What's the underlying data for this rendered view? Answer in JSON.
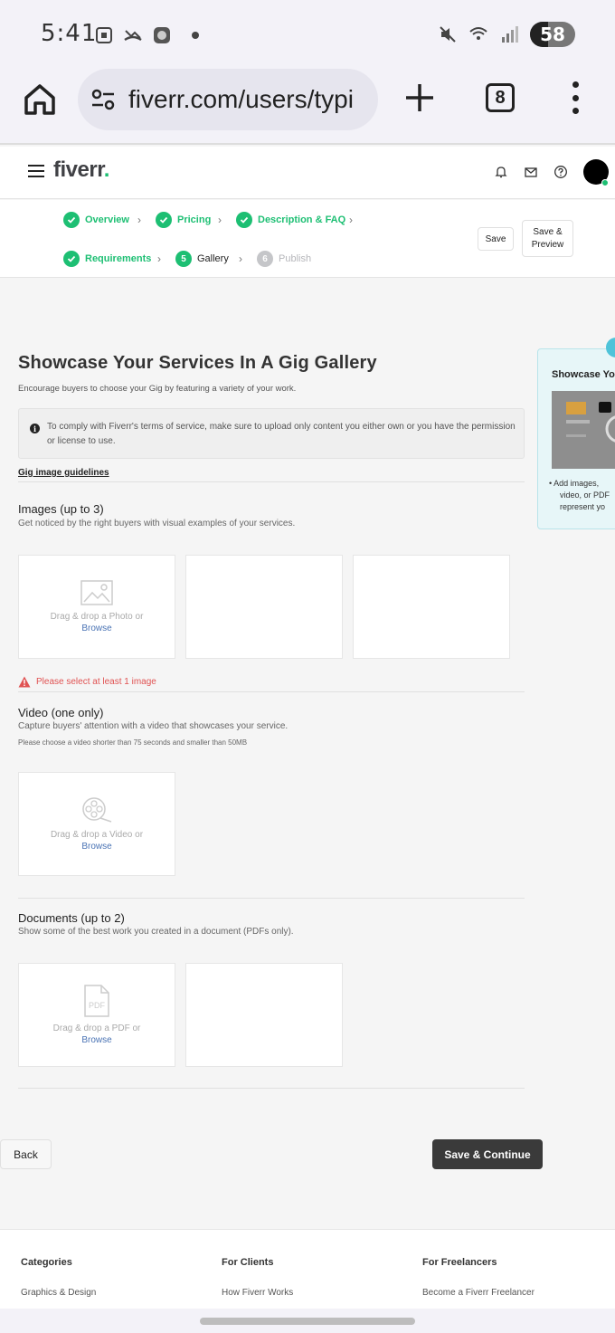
{
  "status_bar": {
    "time": "5:41",
    "battery": "58",
    "icons": [
      "screenshot-icon",
      "missed-call-icon",
      "app-icon",
      "dot",
      "mute-icon",
      "wifi-icon",
      "signal-icon",
      "battery-icon"
    ]
  },
  "browser": {
    "url": "fiverr.com/users/typi",
    "tab_count": "8"
  },
  "header": {
    "logo_text": "fiverr",
    "logo_dot": "."
  },
  "steps": {
    "items": [
      {
        "label": "Overview",
        "state": "done"
      },
      {
        "label": "Pricing",
        "state": "done"
      },
      {
        "label": "Description & FAQ",
        "state": "done"
      },
      {
        "label": "Requirements",
        "state": "done"
      },
      {
        "num": "5",
        "label": "Gallery",
        "state": "active"
      },
      {
        "num": "6",
        "label": "Publish",
        "state": "disabled"
      }
    ],
    "save_label": "Save",
    "save_preview_label": "Save & Preview"
  },
  "main": {
    "title": "Showcase Your Services In A Gig Gallery",
    "subtitle": "Encourage buyers to choose your Gig by featuring a variety of your work.",
    "notice": "To comply with Fiverr's terms of service, make sure to upload only content you either own or you have the permission or license to use.",
    "guidelines_link": "Gig image guidelines",
    "images": {
      "title": "Images (up to 3)",
      "desc": "Get noticed by the right buyers with visual examples of your services.",
      "drop_text": "Drag & drop a Photo or",
      "browse": "Browse",
      "error": "Please select at least 1 image"
    },
    "video": {
      "title": "Video (one only)",
      "desc": "Capture buyers' attention with a video that showcases your service.",
      "note": "Please choose a video shorter than 75 seconds and smaller than 50MB",
      "drop_text": "Drag & drop a Video or",
      "browse": "Browse"
    },
    "documents": {
      "title": "Documents (up to 2)",
      "desc": "Show some of the best work you created in a document (PDFs only).",
      "drop_text": "Drag & drop a PDF or",
      "browse": "Browse"
    },
    "back_label": "Back",
    "continue_label": "Save & Continue"
  },
  "tooltip": {
    "title": "Showcase Yo",
    "text_lines": [
      "• Add images,",
      "video, or PDF",
      "represent yo"
    ]
  },
  "footer": {
    "columns": [
      {
        "title": "Categories",
        "link": "Graphics & Design"
      },
      {
        "title": "For Clients",
        "link": "How Fiverr Works"
      },
      {
        "title": "For Freelancers",
        "link": "Become a Fiverr Freelancer"
      }
    ]
  },
  "colors": {
    "brand_green": "#1dbf73",
    "error_red": "#e05252",
    "link_blue": "#4a73b4",
    "dark_button": "#3a3a3a"
  }
}
